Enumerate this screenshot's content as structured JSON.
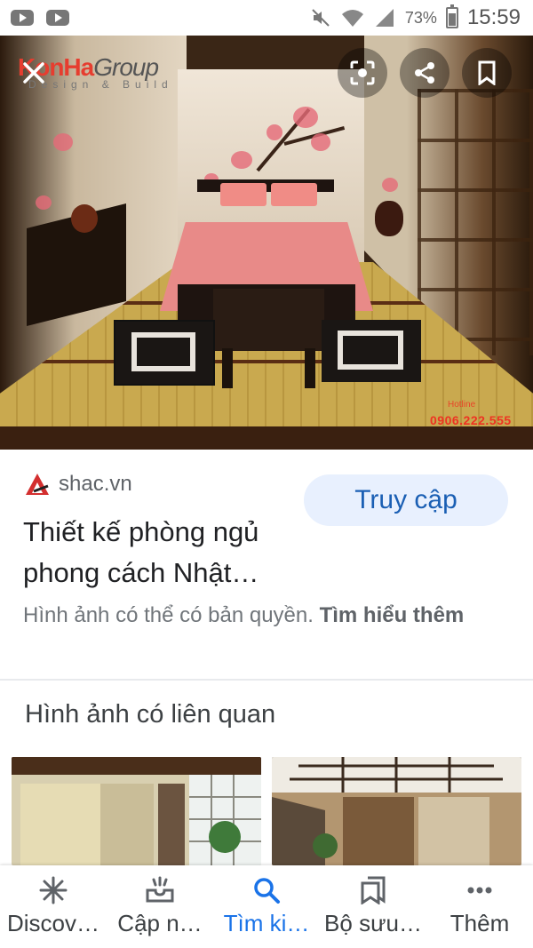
{
  "status_bar": {
    "battery": "73%",
    "time": "15:59",
    "icons": [
      "youtube-icon",
      "youtube-icon",
      "mute-icon",
      "wifi-icon",
      "signal-icon",
      "battery-icon"
    ]
  },
  "image": {
    "logo_main": "KonHa",
    "logo_group": "Group",
    "logo_sub": "Design & Build",
    "hotline_label": "Hotline",
    "hotline_number": "0906.222.555"
  },
  "overlay": {
    "close_icon": "close-icon",
    "lens_icon": "lens-icon",
    "share_icon": "share-icon",
    "bookmark_icon": "bookmark-icon"
  },
  "result": {
    "source": "shac.vn",
    "visit_label": "Truy cập",
    "title": "Thiết kế phòng ngủ phong cách Nhật…",
    "copyright_text": "Hình ảnh có thể có bản quyền.",
    "learn_more": "Tìm hiểu thêm",
    "related_heading": "Hình ảnh có liên quan"
  },
  "bottom_nav": [
    {
      "label": "Discov…",
      "icon": "asterisk-icon",
      "active": false
    },
    {
      "label": "Cập n…",
      "icon": "inbox-updates-icon",
      "active": false
    },
    {
      "label": "Tìm ki…",
      "icon": "search-icon",
      "active": true
    },
    {
      "label": "Bộ sưu…",
      "icon": "collections-icon",
      "active": false
    },
    {
      "label": "Thêm",
      "icon": "more-icon",
      "active": false
    }
  ],
  "colors": {
    "accent": "#1a73e8",
    "visit_bg": "#e8f0fe",
    "text_secondary": "#70757a"
  }
}
